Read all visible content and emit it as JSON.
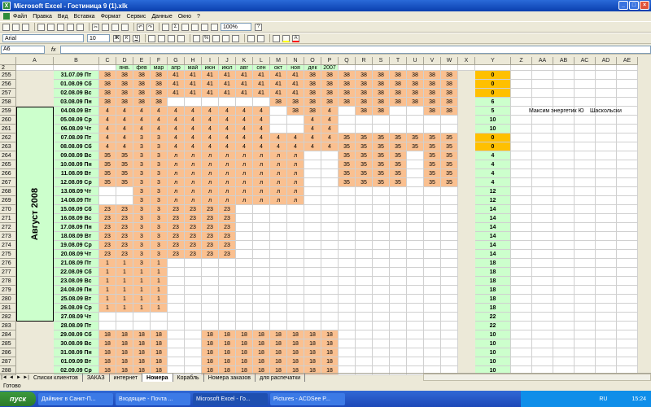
{
  "window": {
    "title": "Microsoft Excel - Гостиница 9 (1).xlk"
  },
  "menu": [
    "Файл",
    "Правка",
    "Вид",
    "Вставка",
    "Формат",
    "Сервис",
    "Данные",
    "Окно",
    "?"
  ],
  "toolbar": {
    "font": "Arial",
    "size": "10",
    "zoom": "100%"
  },
  "namebox": "A6",
  "formula": "",
  "columns": [
    "A",
    "B",
    "C",
    "D",
    "E",
    "F",
    "G",
    "H",
    "I",
    "J",
    "K",
    "L",
    "M",
    "N",
    "O",
    "P",
    "Q",
    "R",
    "S",
    "T",
    "U",
    "V",
    "W",
    "X",
    "Y",
    "Z",
    "AA",
    "AB",
    "AC",
    "AD",
    "AE"
  ],
  "month_row": [
    "",
    "",
    "",
    "янв.",
    "фев",
    "мар",
    "апр",
    "май",
    "июн",
    "июл",
    "авг",
    "сен",
    "окт",
    "ноя",
    "дек",
    "2007",
    "",
    "",
    "",
    "",
    "",
    "",
    "",
    "",
    "",
    "",
    "",
    "",
    "",
    "",
    ""
  ],
  "vertical_label": "Август 2008",
  "note": "Максим энергетик Ю",
  "note2": "Шаскольски",
  "rows": [
    {
      "n": "255",
      "date": "31.07.09 Пт",
      "v": [
        "38",
        "38",
        "38",
        "38",
        "41",
        "41",
        "41",
        "41",
        "41",
        "41",
        "41",
        "41",
        "38",
        "38",
        "38",
        "38",
        "38",
        "38",
        "38",
        "38",
        "38"
      ],
      "y": "0",
      "yc": "gold"
    },
    {
      "n": "256",
      "date": "01.08.09 Сб",
      "v": [
        "38",
        "38",
        "38",
        "38",
        "41",
        "41",
        "41",
        "41",
        "41",
        "41",
        "41",
        "41",
        "38",
        "38",
        "38",
        "38",
        "38",
        "38",
        "38",
        "38",
        "38"
      ],
      "y": "0",
      "yc": "gold"
    },
    {
      "n": "257",
      "date": "02.08.09 Вс",
      "v": [
        "38",
        "38",
        "38",
        "38",
        "41",
        "41",
        "41",
        "41",
        "41",
        "41",
        "41",
        "41",
        "38",
        "38",
        "38",
        "38",
        "38",
        "38",
        "38",
        "38",
        "38"
      ],
      "y": "0",
      "yc": "gold"
    },
    {
      "n": "258",
      "date": "03.08.09 Пн",
      "v": [
        "38",
        "38",
        "38",
        "38",
        "",
        "",
        "",
        "",
        "",
        "",
        "38",
        "38",
        "38",
        "38",
        "38",
        "38",
        "38",
        "38",
        "38",
        "38",
        "38"
      ],
      "y": "6",
      "yc": "green"
    },
    {
      "n": "259",
      "date": "04.08.09 Вт",
      "v": [
        "4",
        "4",
        "4",
        "4",
        "4",
        "4",
        "4",
        "4",
        "4",
        "4",
        "",
        "38",
        "38",
        "4",
        "",
        "38",
        "38",
        "",
        "",
        "38",
        "38"
      ],
      "y": "5",
      "yc": "green"
    },
    {
      "n": "260",
      "date": "05.08.09 Ср",
      "v": [
        "4",
        "4",
        "4",
        "4",
        "4",
        "4",
        "4",
        "4",
        "4",
        "4",
        "",
        "",
        "4",
        "4",
        "",
        "",
        "",
        "",
        "",
        "",
        ""
      ],
      "y": "10",
      "yc": "green"
    },
    {
      "n": "261",
      "date": "06.08.09 Чт",
      "v": [
        "4",
        "4",
        "4",
        "4",
        "4",
        "4",
        "4",
        "4",
        "4",
        "4",
        "",
        "",
        "4",
        "4",
        "",
        "",
        "",
        "",
        "",
        "",
        ""
      ],
      "y": "10",
      "yc": "green"
    },
    {
      "n": "262",
      "date": "07.08.09 Пт",
      "v": [
        "4",
        "4",
        "3",
        "3",
        "4",
        "4",
        "4",
        "4",
        "4",
        "4",
        "4",
        "4",
        "4",
        "4",
        "35",
        "35",
        "35",
        "35",
        "35",
        "35",
        "35"
      ],
      "y": "0",
      "yc": "gold"
    },
    {
      "n": "263",
      "date": "08.08.09 Сб",
      "v": [
        "4",
        "4",
        "3",
        "3",
        "4",
        "4",
        "4",
        "4",
        "4",
        "4",
        "4",
        "4",
        "4",
        "4",
        "35",
        "35",
        "35",
        "35",
        "35",
        "35",
        "35"
      ],
      "y": "0",
      "yc": "gold"
    },
    {
      "n": "264",
      "date": "09.08.09 Вс",
      "v": [
        "35",
        "35",
        "3",
        "3",
        "л",
        "л",
        "л",
        "л",
        "л",
        "л",
        "л",
        "л",
        "",
        "",
        "35",
        "35",
        "35",
        "35",
        "",
        "35",
        "35"
      ],
      "y": "4",
      "yc": "green"
    },
    {
      "n": "265",
      "date": "10.08.09 Пн",
      "v": [
        "35",
        "35",
        "3",
        "3",
        "л",
        "л",
        "л",
        "л",
        "л",
        "л",
        "л",
        "л",
        "",
        "",
        "35",
        "35",
        "35",
        "35",
        "",
        "35",
        "35"
      ],
      "y": "4",
      "yc": "green"
    },
    {
      "n": "266",
      "date": "11.08.09 Вт",
      "v": [
        "35",
        "35",
        "3",
        "3",
        "л",
        "л",
        "л",
        "л",
        "л",
        "л",
        "л",
        "л",
        "",
        "",
        "35",
        "35",
        "35",
        "35",
        "",
        "35",
        "35"
      ],
      "y": "4",
      "yc": "green"
    },
    {
      "n": "267",
      "date": "12.08.09 Ср",
      "v": [
        "35",
        "35",
        "3",
        "3",
        "л",
        "л",
        "л",
        "л",
        "л",
        "л",
        "л",
        "л",
        "",
        "",
        "35",
        "35",
        "35",
        "35",
        "",
        "35",
        "35"
      ],
      "y": "4",
      "yc": "green"
    },
    {
      "n": "268",
      "date": "13.08.09 Чт",
      "v": [
        "",
        "",
        "3",
        "3",
        "л",
        "л",
        "л",
        "л",
        "л",
        "л",
        "л",
        "л",
        "",
        "",
        "",
        "",
        "",
        "",
        "",
        "",
        ""
      ],
      "y": "12",
      "yc": "green"
    },
    {
      "n": "269",
      "date": "14.08.09 Пт",
      "v": [
        "",
        "",
        "3",
        "3",
        "л",
        "л",
        "л",
        "л",
        "л",
        "л",
        "л",
        "л",
        "",
        "",
        "",
        "",
        "",
        "",
        "",
        "",
        ""
      ],
      "y": "12",
      "yc": "green"
    },
    {
      "n": "270",
      "date": "15.08.09 Сб",
      "v": [
        "23",
        "23",
        "3",
        "3",
        "23",
        "23",
        "23",
        "23",
        "",
        "",
        "",
        "",
        "",
        "",
        "",
        "",
        "",
        "",
        "",
        "",
        ""
      ],
      "y": "14",
      "yc": "green"
    },
    {
      "n": "271",
      "date": "16.08.09 Вс",
      "v": [
        "23",
        "23",
        "3",
        "3",
        "23",
        "23",
        "23",
        "23",
        "",
        "",
        "",
        "",
        "",
        "",
        "",
        "",
        "",
        "",
        "",
        "",
        ""
      ],
      "y": "14",
      "yc": "green"
    },
    {
      "n": "272",
      "date": "17.08.09 Пн",
      "v": [
        "23",
        "23",
        "3",
        "3",
        "23",
        "23",
        "23",
        "23",
        "",
        "",
        "",
        "",
        "",
        "",
        "",
        "",
        "",
        "",
        "",
        "",
        ""
      ],
      "y": "14",
      "yc": "green"
    },
    {
      "n": "273",
      "date": "18.08.09 Вт",
      "v": [
        "23",
        "23",
        "3",
        "3",
        "23",
        "23",
        "23",
        "23",
        "",
        "",
        "",
        "",
        "",
        "",
        "",
        "",
        "",
        "",
        "",
        "",
        ""
      ],
      "y": "14",
      "yc": "green"
    },
    {
      "n": "274",
      "date": "19.08.09 Ср",
      "v": [
        "23",
        "23",
        "3",
        "3",
        "23",
        "23",
        "23",
        "23",
        "",
        "",
        "",
        "",
        "",
        "",
        "",
        "",
        "",
        "",
        "",
        "",
        ""
      ],
      "y": "14",
      "yc": "green"
    },
    {
      "n": "275",
      "date": "20.08.09 Чт",
      "v": [
        "23",
        "23",
        "3",
        "3",
        "23",
        "23",
        "23",
        "23",
        "",
        "",
        "",
        "",
        "",
        "",
        "",
        "",
        "",
        "",
        "",
        "",
        ""
      ],
      "y": "14",
      "yc": "green"
    },
    {
      "n": "276",
      "date": "21.08.09 Пт",
      "v": [
        "1",
        "1",
        "3",
        "1",
        "",
        "",
        "",
        "",
        "",
        "",
        "",
        "",
        "",
        "",
        "",
        "",
        "",
        "",
        "",
        "",
        ""
      ],
      "y": "18",
      "yc": "green"
    },
    {
      "n": "277",
      "date": "22.08.09 Сб",
      "v": [
        "1",
        "1",
        "1",
        "1",
        "",
        "",
        "",
        "",
        "",
        "",
        "",
        "",
        "",
        "",
        "",
        "",
        "",
        "",
        "",
        "",
        ""
      ],
      "y": "18",
      "yc": "green"
    },
    {
      "n": "278",
      "date": "23.08.09 Вс",
      "v": [
        "1",
        "1",
        "1",
        "1",
        "",
        "",
        "",
        "",
        "",
        "",
        "",
        "",
        "",
        "",
        "",
        "",
        "",
        "",
        "",
        "",
        ""
      ],
      "y": "18",
      "yc": "green"
    },
    {
      "n": "279",
      "date": "24.08.09 Пн",
      "v": [
        "1",
        "1",
        "1",
        "1",
        "",
        "",
        "",
        "",
        "",
        "",
        "",
        "",
        "",
        "",
        "",
        "",
        "",
        "",
        "",
        "",
        ""
      ],
      "y": "18",
      "yc": "green"
    },
    {
      "n": "280",
      "date": "25.08.09 Вт",
      "v": [
        "1",
        "1",
        "1",
        "1",
        "",
        "",
        "",
        "",
        "",
        "",
        "",
        "",
        "",
        "",
        "",
        "",
        "",
        "",
        "",
        "",
        ""
      ],
      "y": "18",
      "yc": "green"
    },
    {
      "n": "281",
      "date": "26.08.09 Ср",
      "v": [
        "1",
        "1",
        "1",
        "1",
        "",
        "",
        "",
        "",
        "",
        "",
        "",
        "",
        "",
        "",
        "",
        "",
        "",
        "",
        "",
        "",
        ""
      ],
      "y": "18",
      "yc": "green"
    },
    {
      "n": "282",
      "date": "27.08.09 Чт",
      "v": [
        "",
        "",
        "",
        "",
        "",
        "",
        "",
        "",
        "",
        "",
        "",
        "",
        "",
        "",
        "",
        "",
        "",
        "",
        "",
        "",
        ""
      ],
      "y": "22",
      "yc": "green"
    },
    {
      "n": "283",
      "date": "28.08.09 Пт",
      "v": [
        "",
        "",
        "",
        "",
        "",
        "",
        "",
        "",
        "",
        "",
        "",
        "",
        "",
        "",
        "",
        "",
        "",
        "",
        "",
        "",
        ""
      ],
      "y": "22",
      "yc": "green"
    },
    {
      "n": "284",
      "date": "29.08.09 Сб",
      "v": [
        "18",
        "18",
        "18",
        "18",
        "",
        "",
        "18",
        "18",
        "18",
        "18",
        "18",
        "18",
        "18",
        "18",
        "",
        "",
        "",
        "",
        "",
        "",
        ""
      ],
      "y": "10",
      "yc": "green"
    },
    {
      "n": "285",
      "date": "30.08.09 Вс",
      "v": [
        "18",
        "18",
        "18",
        "18",
        "",
        "",
        "18",
        "18",
        "18",
        "18",
        "18",
        "18",
        "18",
        "18",
        "",
        "",
        "",
        "",
        "",
        "",
        ""
      ],
      "y": "10",
      "yc": "green"
    },
    {
      "n": "286",
      "date": "31.08.09 Пн",
      "v": [
        "18",
        "18",
        "18",
        "18",
        "",
        "",
        "18",
        "18",
        "18",
        "18",
        "18",
        "18",
        "18",
        "18",
        "",
        "",
        "",
        "",
        "",
        "",
        ""
      ],
      "y": "10",
      "yc": "green"
    },
    {
      "n": "287",
      "date": "01.09.09 Вт",
      "v": [
        "18",
        "18",
        "18",
        "18",
        "",
        "",
        "18",
        "18",
        "18",
        "18",
        "18",
        "18",
        "18",
        "18",
        "",
        "",
        "",
        "",
        "",
        "",
        ""
      ],
      "y": "10",
      "yc": "green"
    },
    {
      "n": "288",
      "date": "02.09.09 Ср",
      "v": [
        "18",
        "18",
        "18",
        "18",
        "",
        "",
        "18",
        "18",
        "18",
        "18",
        "18",
        "18",
        "18",
        "18",
        "",
        "",
        "",
        "",
        "",
        "",
        ""
      ],
      "y": "10",
      "yc": "green"
    }
  ],
  "sheets": [
    "Списки клиентов",
    "ЗАКАЗ",
    "интернет",
    "Номера",
    "Корабль",
    "Номера заказов",
    "для распечатки"
  ],
  "active_sheet": "Номера",
  "status": "Готово",
  "taskbar": {
    "start": "пуск",
    "items": [
      "Дайвинг в Санкт-П...",
      "Входящие - Почта ...",
      "Microsoft Excel - Го...",
      "Pictures - ACDSee P..."
    ],
    "lang": "RU",
    "time": "15:24"
  }
}
